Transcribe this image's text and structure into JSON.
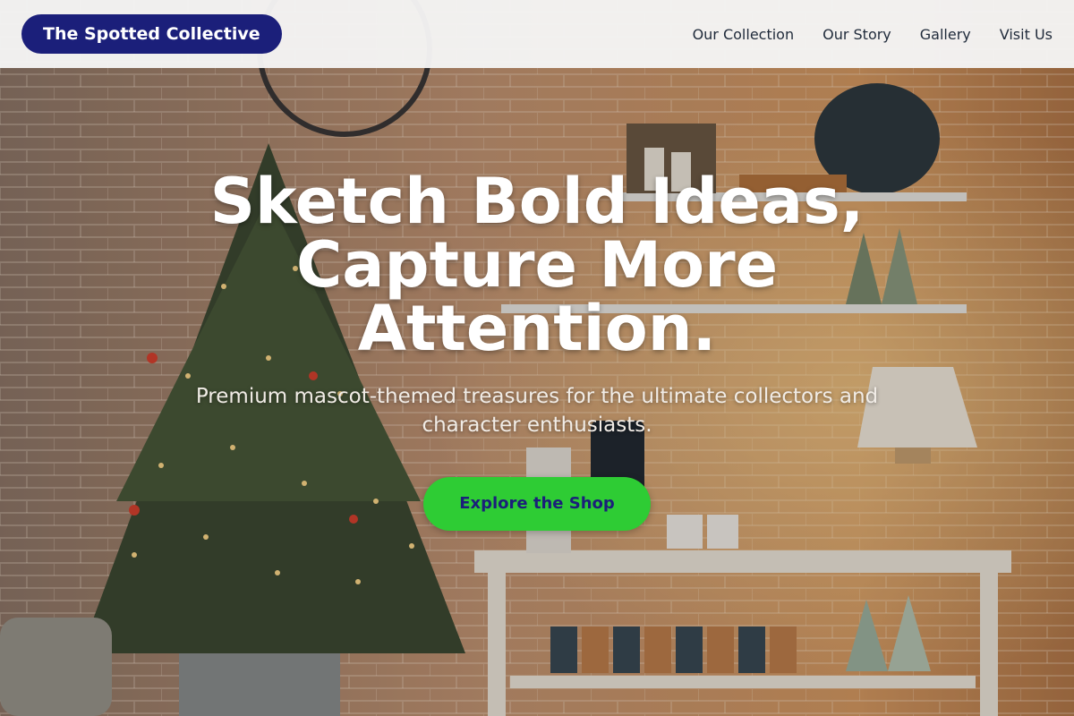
{
  "header": {
    "brand": "The Spotted Collective",
    "nav": [
      {
        "label": "Our Collection"
      },
      {
        "label": "Our Story"
      },
      {
        "label": "Gallery"
      },
      {
        "label": "Visit Us"
      }
    ]
  },
  "hero": {
    "title": "Sketch Bold Ideas, Capture More Attention.",
    "subtitle": "Premium mascot-themed treasures for the ultimate collectors and character enthusiasts.",
    "cta_label": "Explore the Shop",
    "background_image": "brick-wall-shop-interior-with-christmas-tree"
  },
  "colors": {
    "header_bg": "#f5f5f5",
    "brand_bg": "#1b1f7a",
    "brand_text": "#ffffff",
    "nav_text": "#1f2a3a",
    "cta_bg": "#2ecc34",
    "cta_text": "#1b1f7a",
    "title_text": "#ffffff"
  }
}
